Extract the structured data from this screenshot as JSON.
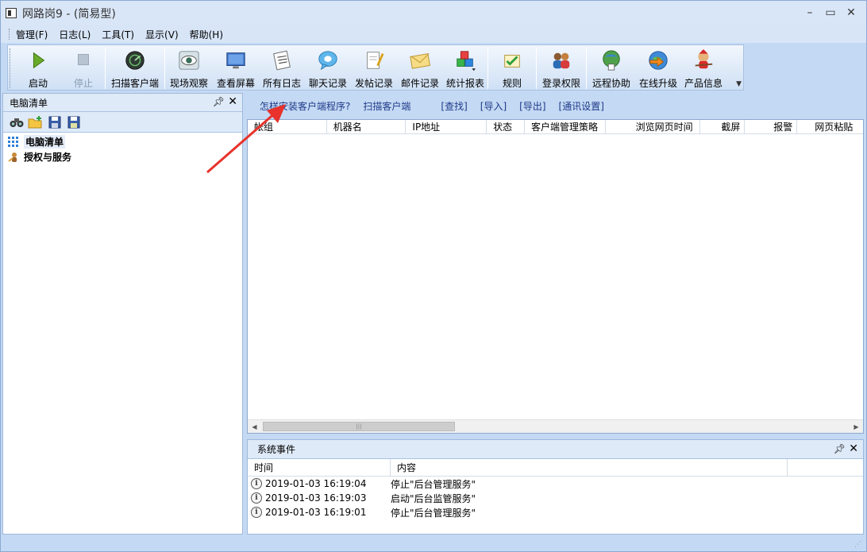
{
  "window": {
    "title": "网路岗9 - (简易型)"
  },
  "menu": [
    {
      "label": "管理(F)"
    },
    {
      "label": "日志(L)"
    },
    {
      "label": "工具(T)"
    },
    {
      "label": "显示(V)"
    },
    {
      "label": "帮助(H)"
    }
  ],
  "toolbar": [
    {
      "label": "启动",
      "icon": "play-icon"
    },
    {
      "label": "停止",
      "icon": "stop-icon"
    },
    {
      "label": "扫描客户端",
      "icon": "scan-icon"
    },
    {
      "label": "现场观察",
      "icon": "eye-icon"
    },
    {
      "label": "查看屏幕",
      "icon": "monitor-icon"
    },
    {
      "label": "所有日志",
      "icon": "log-icon"
    },
    {
      "label": "聊天记录",
      "icon": "chat-icon"
    },
    {
      "label": "发帖记录",
      "icon": "post-icon"
    },
    {
      "label": "邮件记录",
      "icon": "mail-icon"
    },
    {
      "label": "统计报表",
      "icon": "report-icon"
    },
    {
      "label": "规则",
      "icon": "rules-icon"
    },
    {
      "label": "登录权限",
      "icon": "users-icon"
    },
    {
      "label": "远程协助",
      "icon": "remote-icon"
    },
    {
      "label": "在线升级",
      "icon": "update-icon"
    },
    {
      "label": "产品信息",
      "icon": "info-icon"
    }
  ],
  "left_panel": {
    "title": "电脑清单",
    "tree": [
      {
        "label": "电脑清单"
      },
      {
        "label": "授权与服务"
      }
    ]
  },
  "links": {
    "how_install": "怎样安装客户端程序?",
    "scan": "扫描客户端",
    "find": "[查找]",
    "import": "[导入]",
    "export": "[导出]",
    "comm": "[通讯设置]"
  },
  "list": {
    "columns": [
      "帐组",
      "机器名",
      "IP地址",
      "状态",
      "客户端管理策略",
      "浏览网页时间",
      "截屏",
      "报警",
      "网页粘贴"
    ]
  },
  "events": {
    "title": "系统事件",
    "col_time": "时间",
    "col_content": "内容",
    "rows": [
      {
        "time": "2019-01-03 16:19:04",
        "content": "停止\"后台管理服务\""
      },
      {
        "time": "2019-01-03 16:19:03",
        "content": "启动\"后台监管服务\""
      },
      {
        "time": "2019-01-03 16:19:01",
        "content": "停止\"后台管理服务\""
      }
    ]
  }
}
